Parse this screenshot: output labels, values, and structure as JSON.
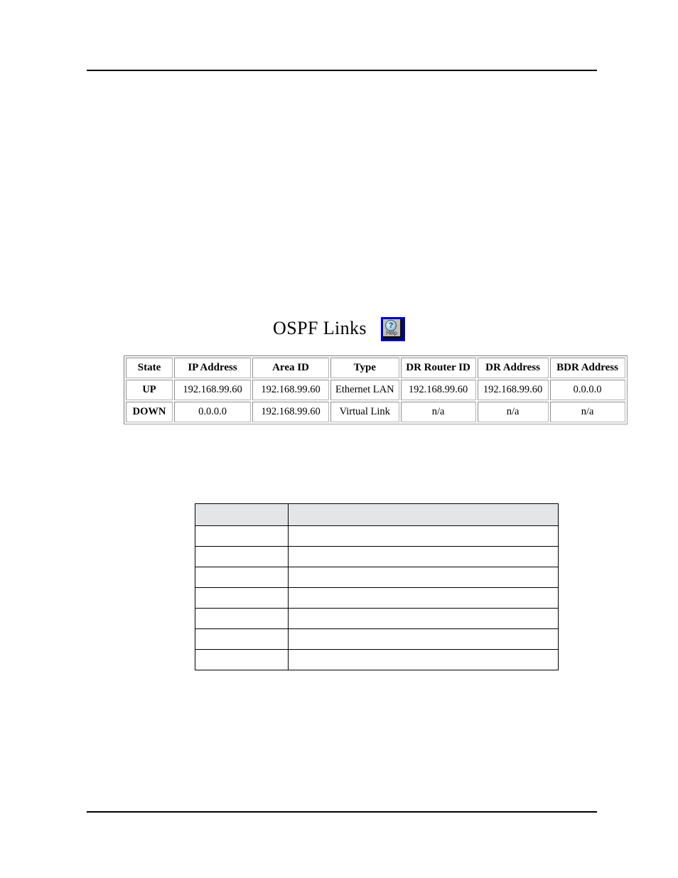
{
  "page": {
    "background_color": "#ffffff",
    "rule_color": "#000000",
    "top_rule": "",
    "bottom_rule": ""
  },
  "heading": {
    "title": "OSPF Links",
    "help_button": {
      "name": "Help",
      "label": "Help",
      "glyph": "?",
      "border_color": "#0000cc",
      "face_color": "#c0c0c0"
    }
  },
  "ospf_table": {
    "caption": "OSPF Links",
    "columns": [
      "State",
      "IP Address",
      "Area ID",
      "Type",
      "DR Router ID",
      "DR Address",
      "BDR Address"
    ],
    "rows": [
      {
        "state": "UP",
        "ip_address": "192.168.99.60",
        "area_id": "192.168.99.60",
        "type": "Ethernet LAN",
        "dr_router_id": "192.168.99.60",
        "dr_address": "192.168.99.60",
        "bdr_address": "0.0.0.0"
      },
      {
        "state": "DOWN",
        "ip_address": "0.0.0.0",
        "area_id": "192.168.99.60",
        "type": "Virtual Link",
        "dr_router_id": "n/a",
        "dr_address": "n/a",
        "bdr_address": "n/a"
      }
    ]
  },
  "blank_table": {
    "header_fill": "#e4e5e7",
    "border_color": "#000000",
    "header_cells": [
      "",
      ""
    ],
    "rows": [
      [
        "",
        ""
      ],
      [
        "",
        ""
      ],
      [
        "",
        ""
      ],
      [
        "",
        ""
      ],
      [
        "",
        ""
      ],
      [
        "",
        ""
      ],
      [
        "",
        ""
      ]
    ]
  }
}
